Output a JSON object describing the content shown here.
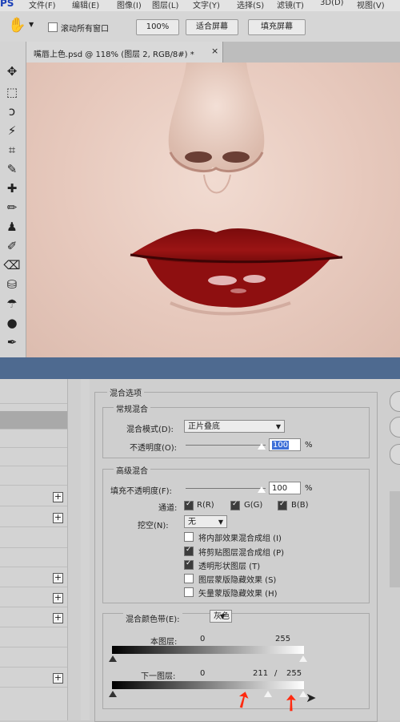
{
  "menubar": {
    "logo": "PS",
    "items": [
      "文件(F)",
      "编辑(E)",
      "图像(I)",
      "图层(L)",
      "文字(Y)",
      "选择(S)",
      "滤镜(T)",
      "3D(D)",
      "视图(V)"
    ]
  },
  "options": {
    "scroll_all_label": "滚动所有窗口",
    "zoom_100": "100%",
    "fit_screen": "适合屏幕",
    "fill_screen": "填充屏幕"
  },
  "document": {
    "tab_title": "嘴唇上色.psd @ 118% (图层 2, RGB/8#) *",
    "close_glyph": "×"
  },
  "dialog": {
    "section_title": "混合选项",
    "general": {
      "title": "常规混合",
      "blend_mode_label": "混合模式(D):",
      "blend_mode_value": "正片叠底",
      "opacity_label": "不透明度(O):",
      "opacity_value": "100",
      "percent": "%"
    },
    "advanced": {
      "title": "高级混合",
      "fill_opacity_label": "填充不透明度(F):",
      "fill_opacity_value": "100",
      "percent": "%",
      "channels_label": "通道:",
      "channel_r": "R(R)",
      "channel_g": "G(G)",
      "channel_b": "B(B)",
      "knockout_label": "挖空(N):",
      "knockout_value": "无",
      "options": [
        {
          "label": "将内部效果混合成组 (I)",
          "checked": false
        },
        {
          "label": "将剪贴图层混合成组 (P)",
          "checked": true
        },
        {
          "label": "透明形状图层 (T)",
          "checked": true
        },
        {
          "label": "图层蒙版隐藏效果 (S)",
          "checked": false
        },
        {
          "label": "矢量蒙版隐藏效果 (H)",
          "checked": false
        }
      ]
    },
    "blend_if": {
      "label": "混合颜色带(E):",
      "value": "灰色",
      "this_layer_label": "本图层:",
      "this_layer_low": "0",
      "this_layer_high": "255",
      "underlying_label": "下一图层:",
      "underlying_low": "0",
      "underlying_split_low": "211",
      "slash": "/",
      "underlying_split_high": "255"
    }
  },
  "colors": {
    "title_bar": "#4e6a90",
    "lip": "#8e0f10",
    "annotation_arrow": "#ff2a10"
  }
}
